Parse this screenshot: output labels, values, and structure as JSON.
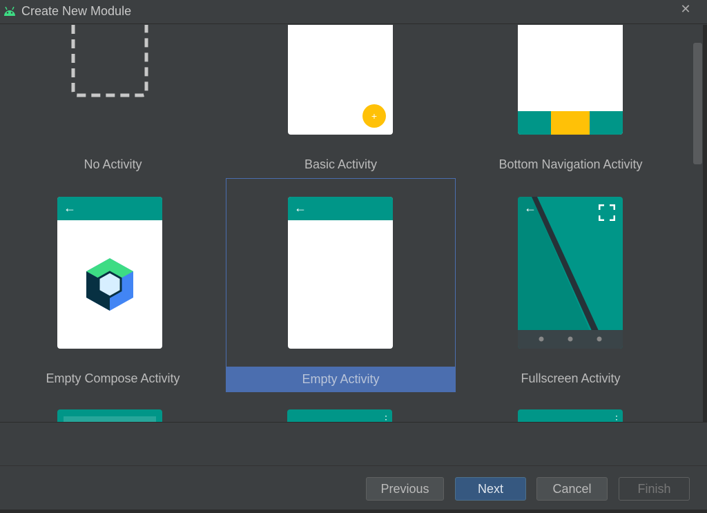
{
  "window": {
    "title": "Create New Module"
  },
  "templates": {
    "row1": [
      "No Activity",
      "Basic Activity",
      "Bottom Navigation Activity"
    ],
    "row2": [
      "Empty Compose Activity",
      "Empty Activity",
      "Fullscreen Activity"
    ],
    "selected": "Empty Activity"
  },
  "buttons": {
    "previous": "Previous",
    "next": "Next",
    "cancel": "Cancel",
    "finish": "Finish"
  },
  "icons": {
    "title_icon": "android-icon",
    "close": "close-icon",
    "close_glyph": "✕",
    "appbar_arrow": "back-arrow-icon",
    "arrow_glyph": "←",
    "fab_glyph": "+",
    "fullscreen": "fullscreen-icon"
  },
  "colors": {
    "teal": "#009688",
    "yellow": "#ffc107",
    "selection": "#4b6eaf",
    "primary_button": "#365880"
  }
}
